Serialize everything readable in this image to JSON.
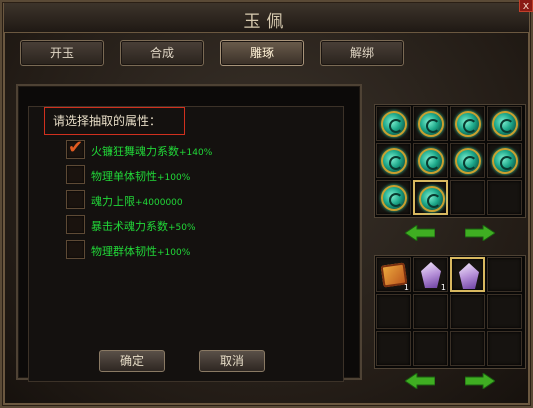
{
  "window": {
    "title": "玉佩",
    "close_label": "x"
  },
  "tabs": [
    {
      "label": "开玉"
    },
    {
      "label": "合成"
    },
    {
      "label": "雕琢"
    },
    {
      "label": "解绑"
    }
  ],
  "active_tab": "雕琢",
  "prompt": "请选择抽取的属性：",
  "attributes": [
    {
      "name": "火镰狂舞魂力系数",
      "value": "+140%",
      "checked": true
    },
    {
      "name": "物理单体韧性",
      "value": "+100%",
      "checked": false
    },
    {
      "name": "魂力上限",
      "value": "+4000000",
      "checked": false
    },
    {
      "name": "暴击术魂力系数",
      "value": "+50%",
      "checked": false
    },
    {
      "name": "物理群体韧性",
      "value": "+100%",
      "checked": false
    }
  ],
  "buttons": {
    "confirm": "确定",
    "cancel": "取消"
  },
  "jade_grid": {
    "columns": 4,
    "rows": 3,
    "items": [
      "jade-pendant-icon",
      "jade-pendant-icon",
      "jade-pendant-icon",
      "jade-pendant-icon",
      "jade-pendant-icon",
      "jade-pendant-icon",
      "jade-pendant-icon",
      "jade-pendant-icon",
      "jade-pendant-icon",
      "jade-pendant-icon",
      "",
      ""
    ],
    "selected_index": 9
  },
  "material_grid": {
    "columns": 4,
    "rows": 3,
    "items": [
      {
        "icon": "scroll-icon",
        "count": "1"
      },
      {
        "icon": "purple-crystal-icon",
        "count": "1"
      },
      {
        "icon": "purple-crystal-icon",
        "count": "",
        "selected": true
      }
    ]
  },
  "colors": {
    "attribute_text": "#21d838",
    "prompt_border": "#d0301e",
    "checkmark": "#e25a20"
  }
}
